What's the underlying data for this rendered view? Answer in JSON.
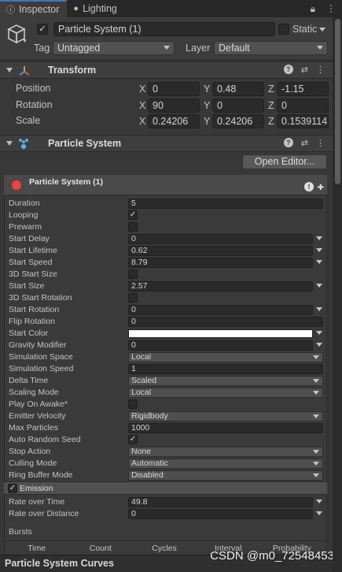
{
  "tabs": [
    {
      "label": "Inspector",
      "icon": "info-icon",
      "active": true
    },
    {
      "label": "Lighting",
      "icon": "light-bulb-icon",
      "active": false
    }
  ],
  "header": {
    "object_name": "Particle System (1)",
    "static_label": "Static",
    "tag_label": "Tag",
    "tag_value": "Untagged",
    "layer_label": "Layer",
    "layer_value": "Default"
  },
  "transform": {
    "title": "Transform",
    "rows": [
      {
        "label": "Position",
        "x": "0",
        "y": "0.48",
        "z": "-1.15"
      },
      {
        "label": "Rotation",
        "x": "90",
        "y": "0",
        "z": "0"
      },
      {
        "label": "Scale",
        "x": "0.24206",
        "y": "0.24206",
        "z": "0.1539114"
      }
    ],
    "axes": [
      "X",
      "Y",
      "Z"
    ]
  },
  "particle_component": {
    "title": "Particle System",
    "open_editor": "Open Editor...",
    "module_name": "Particle System (1)",
    "props": [
      {
        "label": "Duration",
        "kind": "field",
        "value": "5"
      },
      {
        "label": "Looping",
        "kind": "check",
        "value": "✓"
      },
      {
        "label": "Prewarm",
        "kind": "check",
        "value": ""
      },
      {
        "label": "Start Delay",
        "kind": "fieldarrow",
        "value": "0"
      },
      {
        "label": "Start Lifetime",
        "kind": "fieldarrow",
        "value": "0.62"
      },
      {
        "label": "Start Speed",
        "kind": "fieldarrow",
        "value": "8.79"
      },
      {
        "label": "3D Start Size",
        "kind": "check",
        "value": ""
      },
      {
        "label": "Start Size",
        "kind": "fieldarrow",
        "value": "2.57"
      },
      {
        "label": "3D Start Rotation",
        "kind": "check",
        "value": ""
      },
      {
        "label": "Start Rotation",
        "kind": "fieldarrow",
        "value": "0"
      },
      {
        "label": "Flip Rotation",
        "kind": "field",
        "value": "0"
      },
      {
        "label": "Start Color",
        "kind": "color",
        "value": ""
      },
      {
        "label": "Gravity Modifier",
        "kind": "fieldarrow",
        "value": "0"
      },
      {
        "label": "Simulation Space",
        "kind": "dropdown",
        "value": "Local"
      },
      {
        "label": "Simulation Speed",
        "kind": "field",
        "value": "1"
      },
      {
        "label": "Delta Time",
        "kind": "dropdown",
        "value": "Scaled"
      },
      {
        "label": "Scaling Mode",
        "kind": "dropdown",
        "value": "Local"
      },
      {
        "label": "Play On Awake*",
        "kind": "check",
        "value": ""
      },
      {
        "label": "Emitter Velocity",
        "kind": "dropdown",
        "value": "Rigidbody"
      },
      {
        "label": "Max Particles",
        "kind": "field",
        "value": "1000"
      },
      {
        "label": "Auto Random Seed",
        "kind": "check",
        "value": "✓"
      },
      {
        "label": "Stop Action",
        "kind": "dropdown",
        "value": "None"
      },
      {
        "label": "Culling Mode",
        "kind": "dropdown",
        "value": "Automatic"
      },
      {
        "label": "Ring Buffer Mode",
        "kind": "dropdown",
        "value": "Disabled"
      }
    ],
    "emission": {
      "label": "Emission",
      "checked": "✓",
      "rows": [
        {
          "label": "Rate over Time",
          "value": "49.8"
        },
        {
          "label": "Rate over Distance",
          "value": "0"
        }
      ],
      "bursts_label": "Bursts",
      "bursts_columns": [
        "Time",
        "Count",
        "Cycles",
        "Interval",
        "Probability"
      ]
    }
  },
  "curves_label": "Particle System Curves",
  "watermark": "CSDN @m0_72548453",
  "colors": {
    "accent": "#3a79bb",
    "start_color": "#ffffff",
    "module_dot": "#e5463f"
  }
}
